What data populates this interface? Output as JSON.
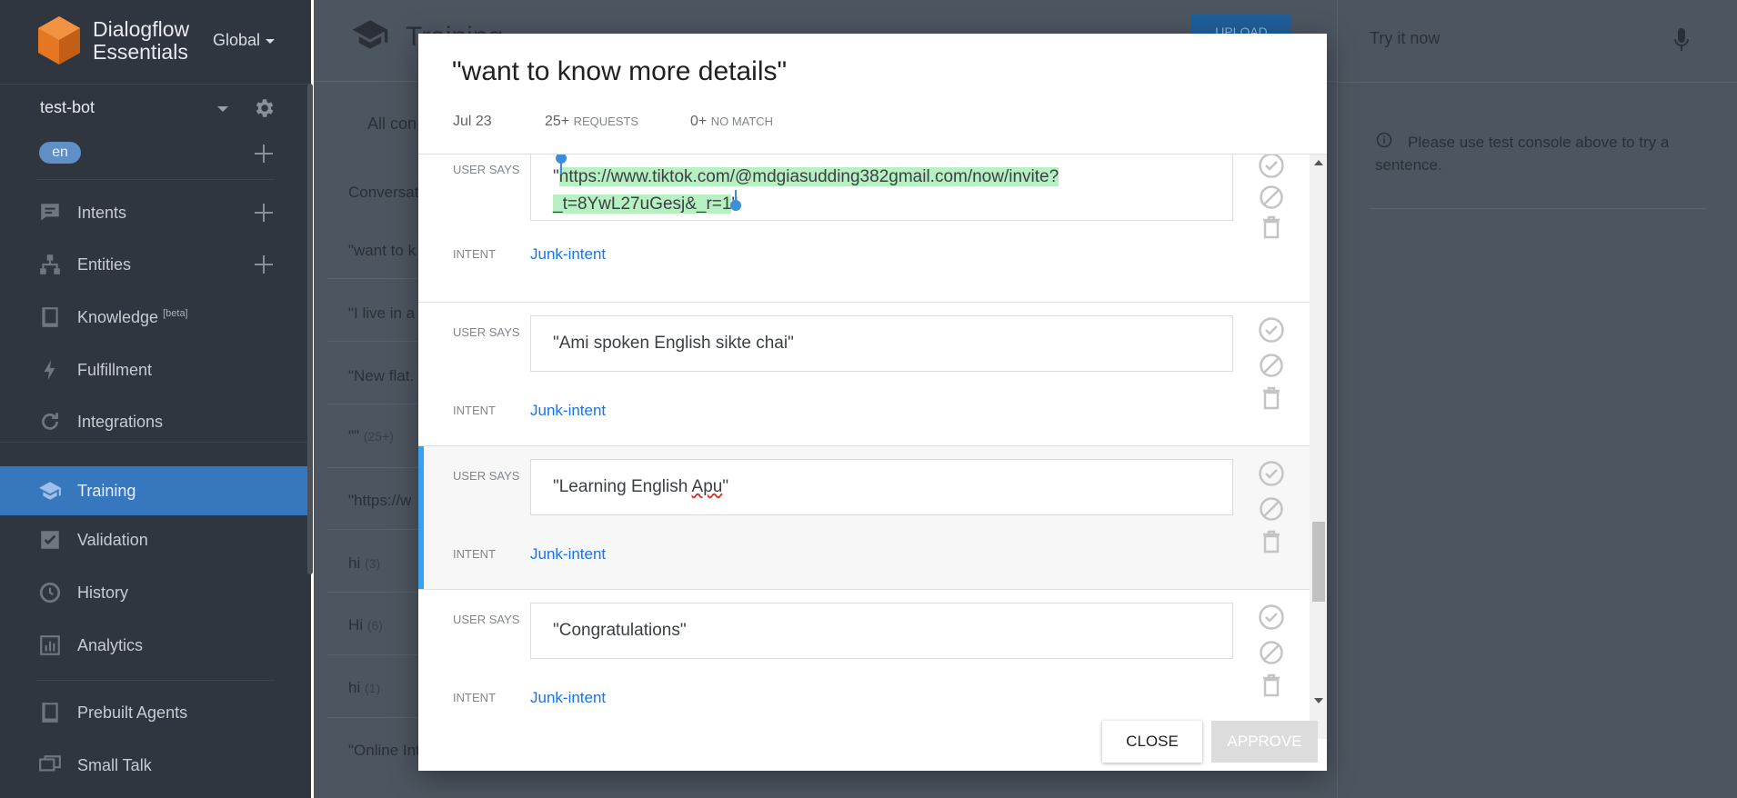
{
  "brand": {
    "name_line1": "Dialogflow",
    "name_line2": "Essentials",
    "region": "Global"
  },
  "agent": {
    "name": "test-bot",
    "language": "en"
  },
  "sidebar": {
    "items": [
      {
        "label": "Intents",
        "icon": "chat-icon"
      },
      {
        "label": "Entities",
        "icon": "hierarchy-icon"
      },
      {
        "label": "Knowledge",
        "badge": "[beta]",
        "icon": "book-icon"
      },
      {
        "label": "Fulfillment",
        "icon": "bolt-icon"
      },
      {
        "label": "Integrations",
        "icon": "refresh-icon"
      },
      {
        "label": "Training",
        "icon": "graduation-cap-icon",
        "active": true
      },
      {
        "label": "Validation",
        "icon": "check-square-icon"
      },
      {
        "label": "History",
        "icon": "clock-icon"
      },
      {
        "label": "Analytics",
        "icon": "bar-chart-icon"
      },
      {
        "label": "Prebuilt Agents",
        "icon": "book-icon"
      },
      {
        "label": "Small Talk",
        "icon": "chat-bubbles-icon"
      }
    ]
  },
  "main": {
    "title": "Training",
    "upload": "UPLOAD",
    "tab": "All con",
    "conversations_header": "Conversat",
    "rows": [
      {
        "text": "\"want to k",
        "count": ""
      },
      {
        "text": "\"I live in a",
        "count": ""
      },
      {
        "text": "\"New flat.",
        "count": ""
      },
      {
        "text": "\"\"",
        "count": "(25+)"
      },
      {
        "text": "\"https://w",
        "count": ""
      },
      {
        "text": "hi",
        "count": "(3)"
      },
      {
        "text": "Hi",
        "count": "(6)"
      },
      {
        "text": "hi",
        "count": "(1)"
      },
      {
        "text": "\"Online Int",
        "count": ""
      }
    ]
  },
  "right_panel": {
    "try_placeholder": "Try it now",
    "info": "Please use test console above to try a sentence."
  },
  "modal": {
    "title": "\"want to know more details\"",
    "date": "Jul 23",
    "requests_count": "25+",
    "requests_label": "REQUESTS",
    "nomatch_count": "0+",
    "nomatch_label": "NO MATCH",
    "user_says_label": "USER SAYS",
    "intent_label": "INTENT",
    "examples": [
      {
        "say_pre": "\"",
        "say_hl": "https://www.tiktok.com/@mdgiasudding382gmail.com/now/invite?_t=8YwL27uGesj&_r=1",
        "say_post": "\"",
        "intent": "Junk-intent"
      },
      {
        "say": "\"Ami spoken English sikte chai\"",
        "intent": "Junk-intent"
      },
      {
        "say_pre": "\"Learning English ",
        "say_err": "Apu",
        "say_post": "\"",
        "intent": "Junk-intent",
        "selected": true
      },
      {
        "say": "\"Congratulations\"",
        "intent": "Junk-intent"
      }
    ],
    "close": "CLOSE",
    "approve": "APPROVE"
  }
}
